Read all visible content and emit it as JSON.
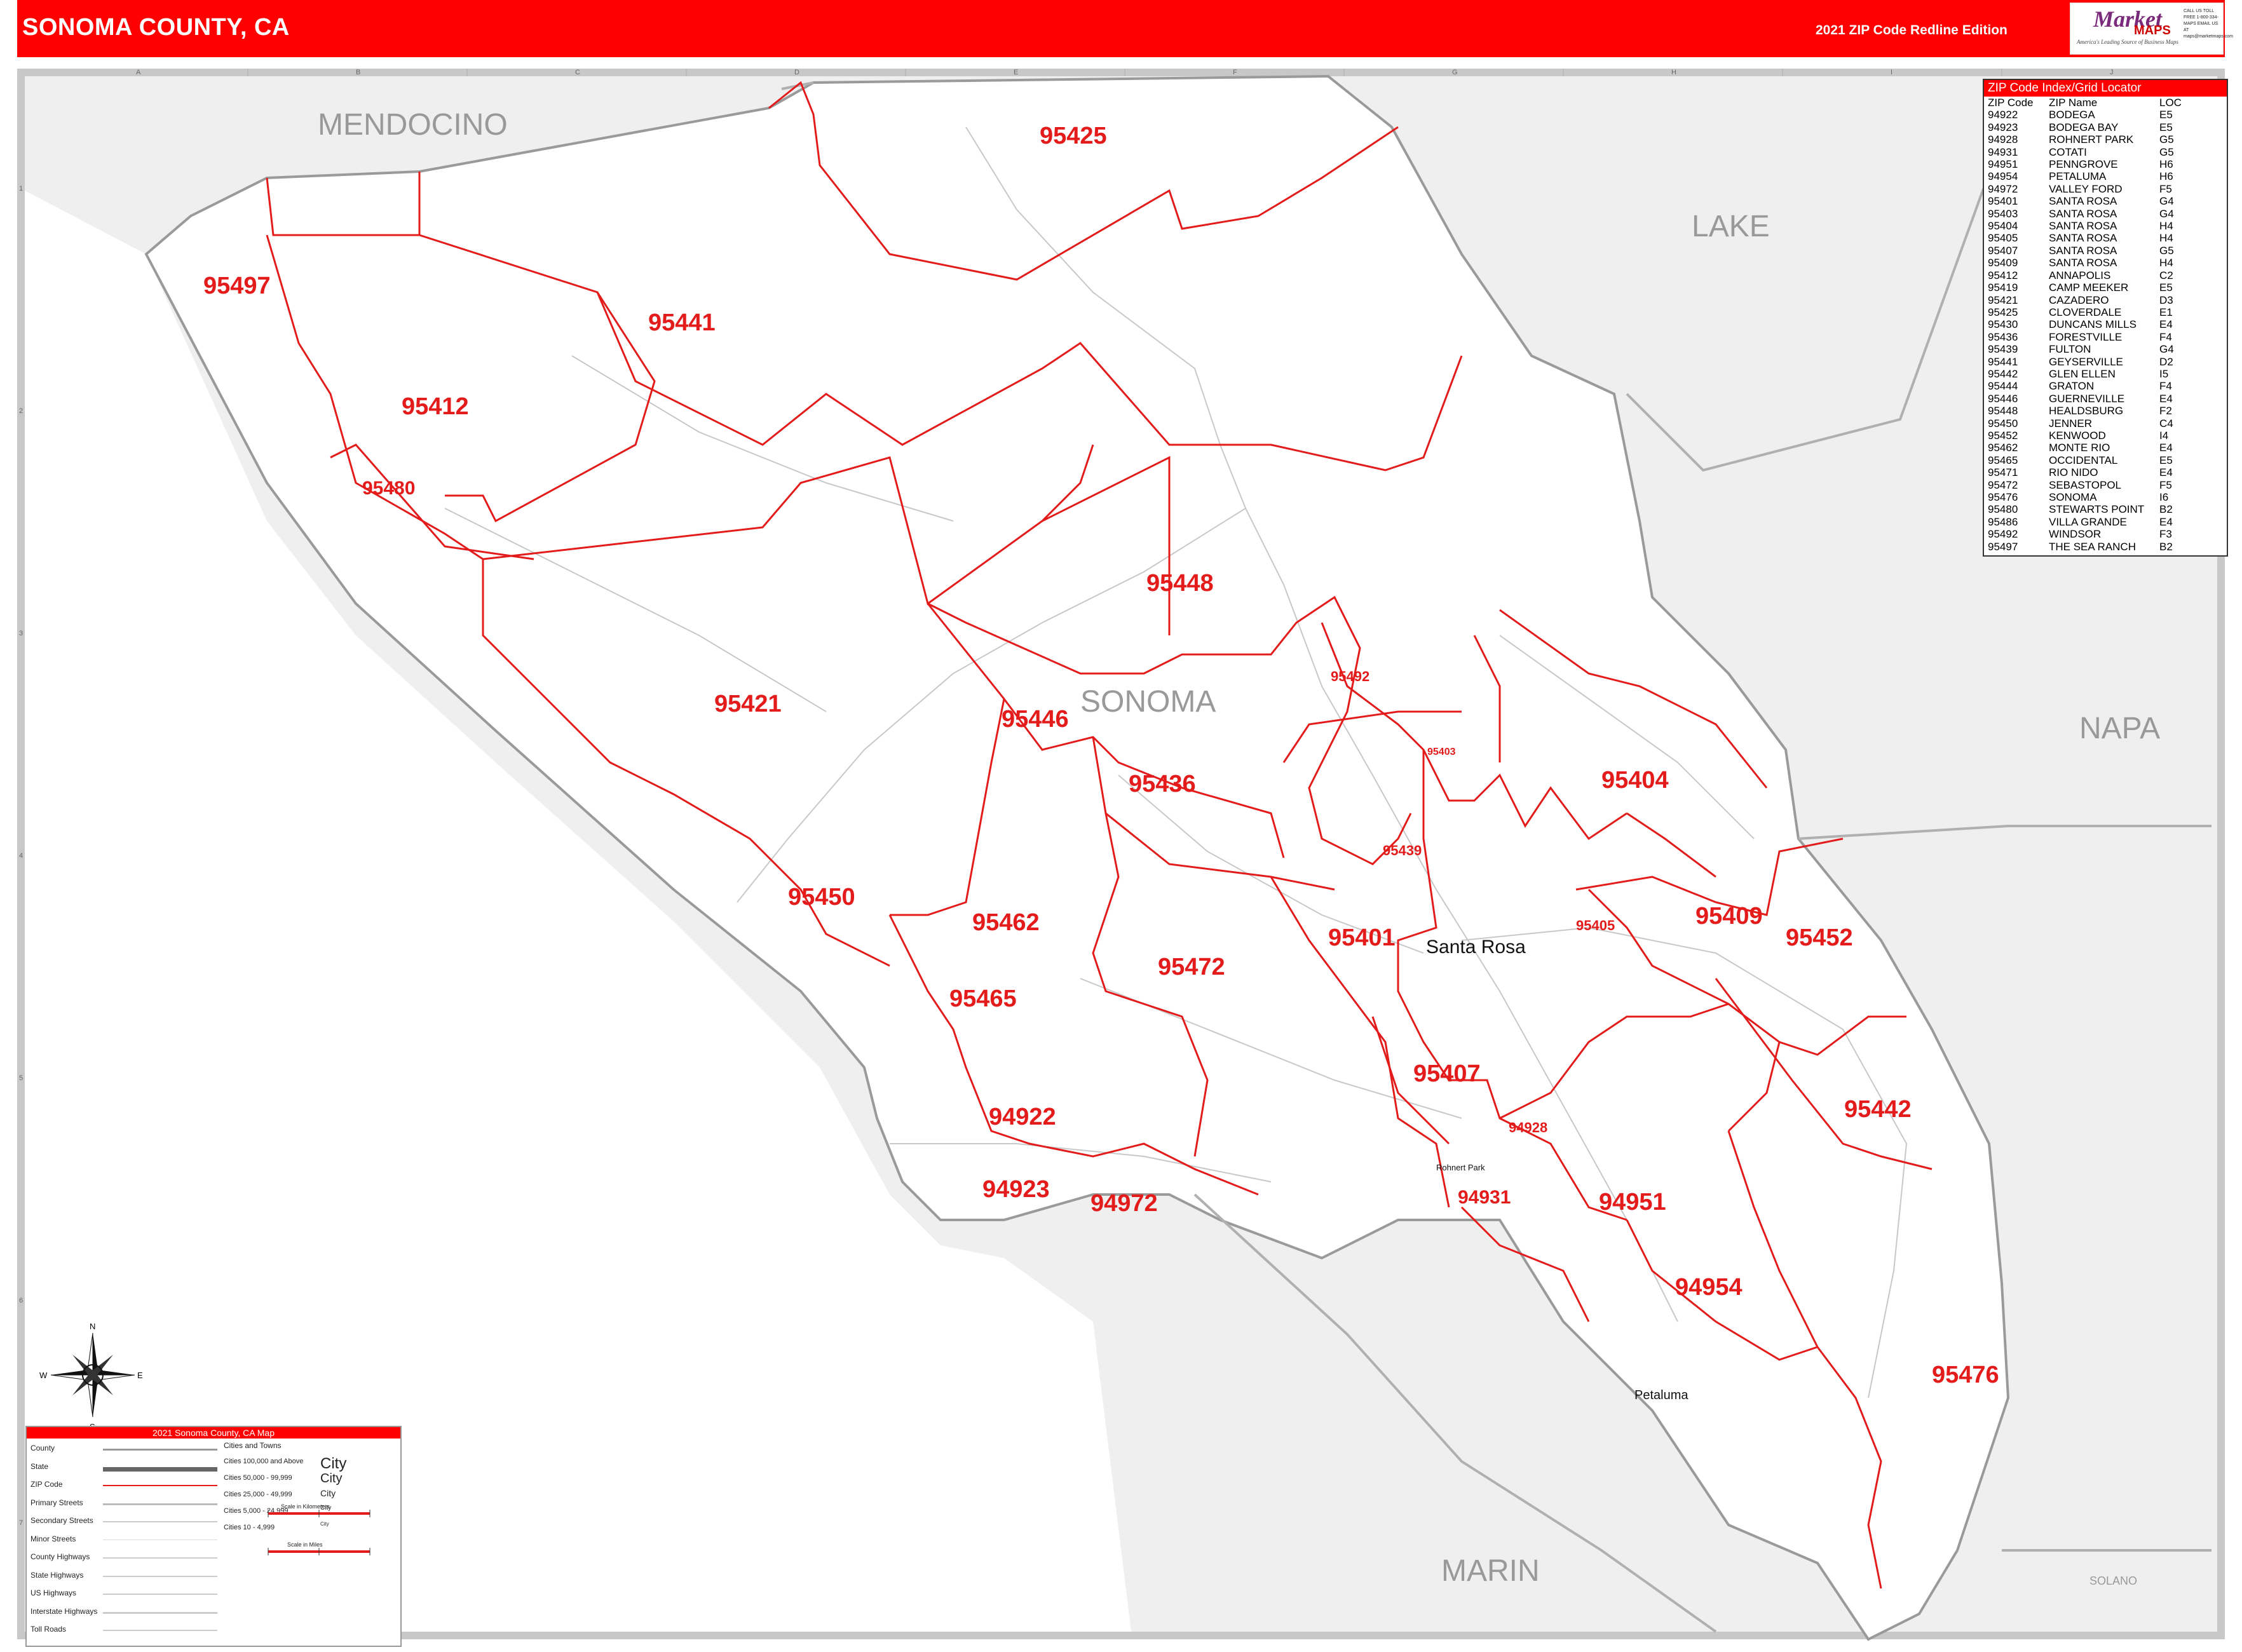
{
  "header": {
    "title": "SONOMA COUNTY, CA",
    "edition": "2021 ZIP Code Redline Edition"
  },
  "logo": {
    "brand_top": "Market",
    "brand_bottom": "MAPS",
    "tagline": "America's Leading Source of Business Maps",
    "contact": "CALL US TOLL FREE 1-800-334-MAPS EMAIL US AT maps@marketmaps.com"
  },
  "grid": {
    "columns": [
      "A",
      "B",
      "C",
      "D",
      "E",
      "F",
      "G",
      "H",
      "I",
      "J"
    ],
    "rows": [
      "1",
      "2",
      "3",
      "4",
      "5",
      "6",
      "7"
    ]
  },
  "counties": {
    "mendocino": "MENDOCINO",
    "lake": "LAKE",
    "sonoma": "SONOMA",
    "napa": "NAPA",
    "marin": "MARIN",
    "solano": "SOLANO"
  },
  "cities": {
    "santa_rosa": "Santa Rosa",
    "petaluma": "Petaluma",
    "rohnert_park": "Rohnert Park"
  },
  "zip_labels": [
    {
      "zip": "95425",
      "size": "big"
    },
    {
      "zip": "95497",
      "size": "big"
    },
    {
      "zip": "95441",
      "size": "big"
    },
    {
      "zip": "95412",
      "size": "big"
    },
    {
      "zip": "95480",
      "size": "med"
    },
    {
      "zip": "95448",
      "size": "big"
    },
    {
      "zip": "95421",
      "size": "big"
    },
    {
      "zip": "95446",
      "size": "big"
    },
    {
      "zip": "95492",
      "size": "small"
    },
    {
      "zip": "95403",
      "size": "tiny"
    },
    {
      "zip": "95404",
      "size": "big"
    },
    {
      "zip": "95436",
      "size": "big"
    },
    {
      "zip": "95439",
      "size": "small"
    },
    {
      "zip": "95450",
      "size": "big"
    },
    {
      "zip": "95462",
      "size": "big"
    },
    {
      "zip": "95401",
      "size": "big"
    },
    {
      "zip": "95405",
      "size": "small"
    },
    {
      "zip": "95409",
      "size": "big"
    },
    {
      "zip": "95452",
      "size": "big"
    },
    {
      "zip": "95472",
      "size": "big"
    },
    {
      "zip": "95465",
      "size": "big"
    },
    {
      "zip": "95407",
      "size": "big"
    },
    {
      "zip": "95442",
      "size": "big"
    },
    {
      "zip": "94922",
      "size": "big"
    },
    {
      "zip": "94928",
      "size": "small"
    },
    {
      "zip": "94923",
      "size": "big"
    },
    {
      "zip": "94972",
      "size": "big"
    },
    {
      "zip": "94931",
      "size": "med"
    },
    {
      "zip": "94951",
      "size": "big"
    },
    {
      "zip": "94954",
      "size": "big"
    },
    {
      "zip": "95476",
      "size": "big"
    }
  ],
  "zip_index": {
    "title": "ZIP Code Index/Grid Locator",
    "headers": [
      "ZIP Code",
      "ZIP Name",
      "LOC"
    ],
    "rows": [
      [
        "94922",
        "BODEGA",
        "E5"
      ],
      [
        "94923",
        "BODEGA BAY",
        "E5"
      ],
      [
        "94928",
        "ROHNERT PARK",
        "G5"
      ],
      [
        "94931",
        "COTATI",
        "G5"
      ],
      [
        "94951",
        "PENNGROVE",
        "H6"
      ],
      [
        "94954",
        "PETALUMA",
        "H6"
      ],
      [
        "94972",
        "VALLEY FORD",
        "F5"
      ],
      [
        "95401",
        "SANTA ROSA",
        "G4"
      ],
      [
        "95403",
        "SANTA ROSA",
        "G4"
      ],
      [
        "95404",
        "SANTA ROSA",
        "H4"
      ],
      [
        "95405",
        "SANTA ROSA",
        "H4"
      ],
      [
        "95407",
        "SANTA ROSA",
        "G5"
      ],
      [
        "95409",
        "SANTA ROSA",
        "H4"
      ],
      [
        "95412",
        "ANNAPOLIS",
        "C2"
      ],
      [
        "95419",
        "CAMP MEEKER",
        "E5"
      ],
      [
        "95421",
        "CAZADERO",
        "D3"
      ],
      [
        "95425",
        "CLOVERDALE",
        "E1"
      ],
      [
        "95430",
        "DUNCANS MILLS",
        "E4"
      ],
      [
        "95436",
        "FORESTVILLE",
        "F4"
      ],
      [
        "95439",
        "FULTON",
        "G4"
      ],
      [
        "95441",
        "GEYSERVILLE",
        "D2"
      ],
      [
        "95442",
        "GLEN ELLEN",
        "I5"
      ],
      [
        "95444",
        "GRATON",
        "F4"
      ],
      [
        "95446",
        "GUERNEVILLE",
        "E4"
      ],
      [
        "95448",
        "HEALDSBURG",
        "F2"
      ],
      [
        "95450",
        "JENNER",
        "C4"
      ],
      [
        "95452",
        "KENWOOD",
        "I4"
      ],
      [
        "95462",
        "MONTE RIO",
        "E4"
      ],
      [
        "95465",
        "OCCIDENTAL",
        "E5"
      ],
      [
        "95471",
        "RIO NIDO",
        "E4"
      ],
      [
        "95472",
        "SEBASTOPOL",
        "F5"
      ],
      [
        "95476",
        "SONOMA",
        "I6"
      ],
      [
        "95480",
        "STEWARTS POINT",
        "B2"
      ],
      [
        "95486",
        "VILLA GRANDE",
        "E4"
      ],
      [
        "95492",
        "WINDSOR",
        "F3"
      ],
      [
        "95497",
        "THE SEA RANCH",
        "B2"
      ]
    ]
  },
  "legend": {
    "title": "2021 Sonoma County, CA Map",
    "line_items": [
      "County",
      "State",
      "ZIP Code",
      "Primary Streets",
      "Secondary Streets",
      "Minor Streets",
      "County Highways",
      "State Highways",
      "US Highways",
      "Interstate Highways",
      "Toll Roads"
    ],
    "cities_title": "Cities and Towns",
    "city_classes": [
      "Cities 100,000 and Above",
      "Cities 50,000 - 99,999",
      "Cities 25,000 - 49,999",
      "Cities 5,000 - 24,999",
      "Cities 10 - 4,999"
    ],
    "city_samples": [
      "City",
      "City",
      "City",
      "City",
      "City"
    ],
    "scale_km": "Scale in Kilometers",
    "scale_mi": "Scale in Miles"
  },
  "compass": {
    "n": "N",
    "s": "S",
    "e": "E",
    "w": "W"
  },
  "colors": {
    "header": "#ff0000",
    "zip_line": "#e31b1b",
    "zip_text": "#e31b1b",
    "county_line": "#9a9a9a",
    "outside": "#efefef",
    "ocean": "#ffffff"
  }
}
